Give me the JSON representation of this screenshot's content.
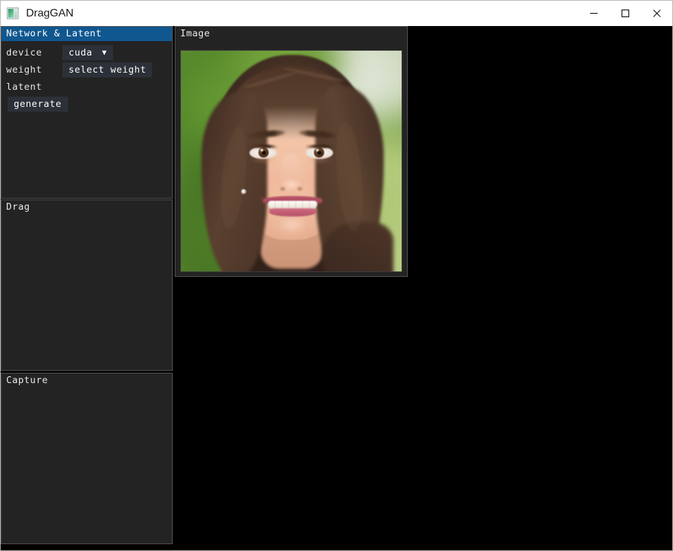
{
  "window": {
    "title": "DragGAN",
    "icon": "image-thumbnail-icon",
    "controls": {
      "minimize": "minimize-icon",
      "maximize": "maximize-icon",
      "close": "close-icon"
    }
  },
  "theme": {
    "accent_header": "#10578f",
    "panel_bg": "#232323",
    "panel_border": "#545454",
    "widget_bg": "#2c3038",
    "text": "#e8e8e8",
    "titlebar_bg": "#ffffff",
    "workspace_bg": "#000000"
  },
  "panels": {
    "network": {
      "header": "Network & Latent",
      "active": true,
      "rows": {
        "device": {
          "label": "device",
          "combo_value": "cuda",
          "combo_arrow": "▼",
          "options": [
            "cuda"
          ]
        },
        "weight": {
          "label": "weight",
          "button": "select weight"
        },
        "latent": {
          "label": "latent"
        },
        "generate": {
          "button": "generate"
        }
      }
    },
    "drag": {
      "header": "Drag",
      "active": false
    },
    "capture": {
      "header": "Capture",
      "active": false
    },
    "image": {
      "header": "Image",
      "active": false,
      "canvas": {
        "alt": "generated-portrait",
        "description": "GAN generated portrait of a smiling young woman with long brown hair against a blurred green outdoor background"
      }
    }
  }
}
